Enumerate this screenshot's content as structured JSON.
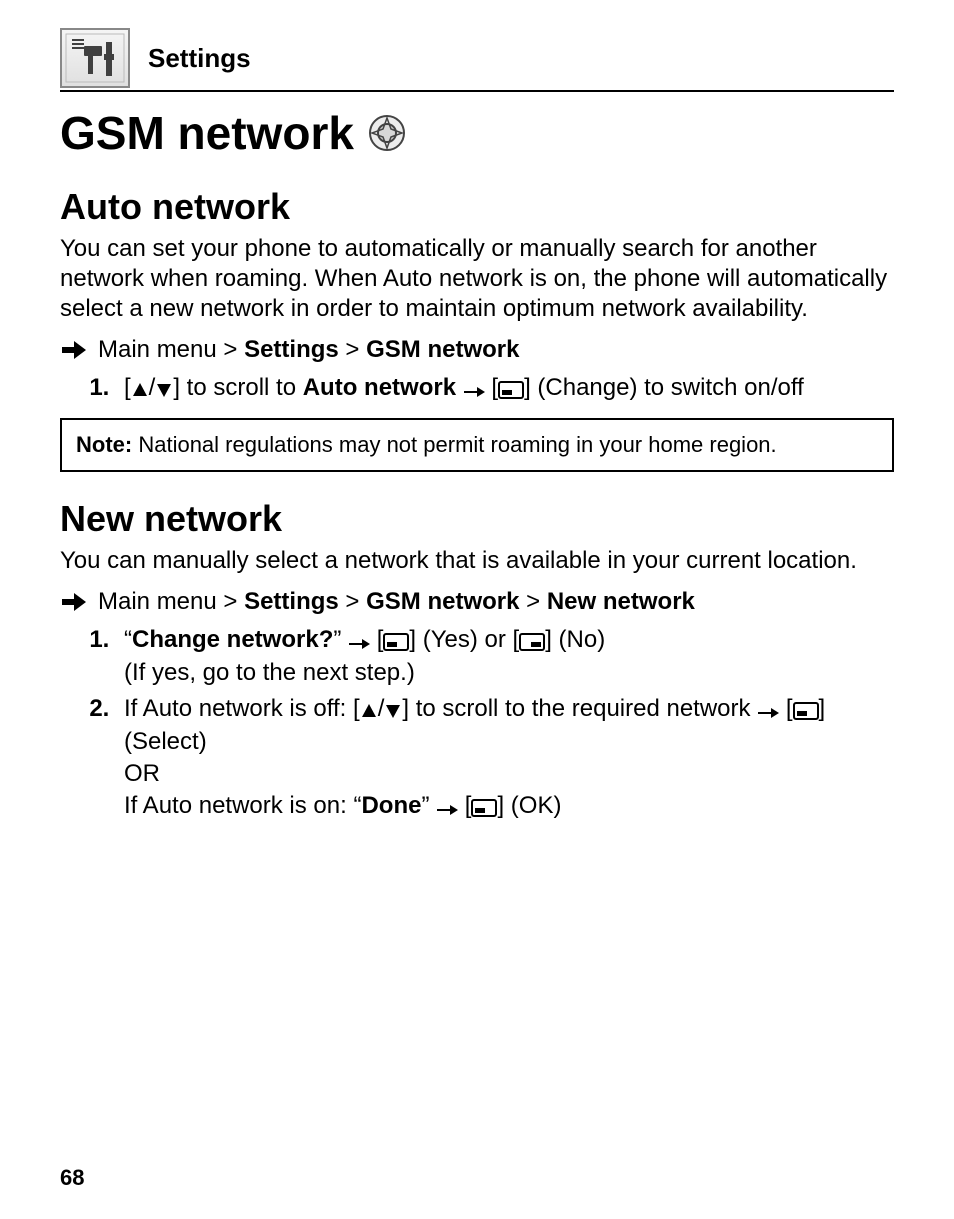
{
  "header": {
    "label": "Settings"
  },
  "title": "GSM network",
  "auto": {
    "heading": "Auto network",
    "desc": "You can set your phone to automatically or manually search for another network when roaming. When Auto network is on, the phone will automatically select a new network in order to maintain optimum network availability.",
    "nav": {
      "prefix": "Main menu > ",
      "seg1": "Settings",
      "sep1": " > ",
      "seg2": "GSM network"
    },
    "step1": {
      "open": "[",
      "slash": "/",
      "close": "] to scroll to ",
      "target": "Auto network",
      "arrow_open": " [",
      "arrow_close": "] (Change) to switch on/off"
    },
    "note_label": "Note:",
    "note_text": " National regulations may not permit roaming in your home region."
  },
  "newnet": {
    "heading": "New network",
    "desc": "You can manually select a network that is available in your current location.",
    "nav": {
      "prefix": "Main menu > ",
      "seg1": "Settings",
      "sep1": " > ",
      "seg2": "GSM network",
      "sep2": " > ",
      "seg3": "New network"
    },
    "step1": {
      "q_open": "“",
      "q_text": "Change network?",
      "q_close": "” ",
      "mid1": " [",
      "yes": "] (Yes) or [",
      "no": "] (No)",
      "line2": "(If yes, go to the next step.)"
    },
    "step2": {
      "off_pre": "If Auto network is off: [",
      "slash": "/",
      "off_mid": "] to scroll to the required network ",
      "select_open": " [",
      "select_close": "] (Select)",
      "or": "OR",
      "on_pre": "If Auto network is on: “",
      "done": "Done",
      "on_mid": "” ",
      "ok_open": " [",
      "ok_close": "] (OK)"
    }
  },
  "page_number": "68"
}
